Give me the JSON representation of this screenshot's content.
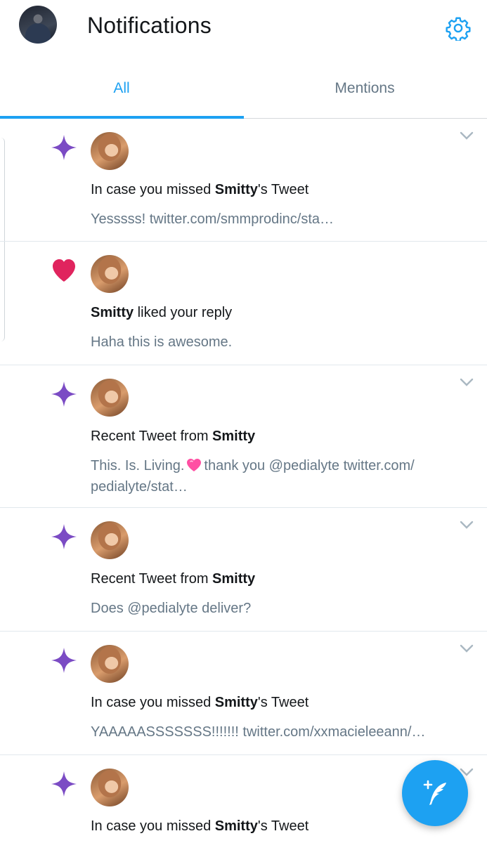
{
  "header": {
    "title": "Notifications",
    "settings_icon": "gear-icon",
    "accent_color": "#1da1f2"
  },
  "tabs": [
    {
      "label": "All",
      "selected": true
    },
    {
      "label": "Mentions",
      "selected": false
    }
  ],
  "notifications": [
    {
      "type_icon": "sparkle-icon",
      "headline_prefix": "In case you missed ",
      "headline_name": "Smitty",
      "headline_suffix": "'s Tweet",
      "preview": "Yesssss! twitter.com/smmprodinc/sta…",
      "has_chevron": true
    },
    {
      "type_icon": "heart-icon",
      "headline_prefix": "",
      "headline_name": "Smitty",
      "headline_suffix": " liked your reply",
      "preview": "Haha this is awesome.",
      "has_chevron": false
    },
    {
      "type_icon": "sparkle-icon",
      "headline_prefix": "Recent Tweet from ",
      "headline_name": "Smitty",
      "headline_suffix": "",
      "preview_before_emoji": "This. Is. Living.",
      "preview_after_emoji": "thank you @pedialyte twitter.com/ pedialyte/stat…",
      "has_chevron": true
    },
    {
      "type_icon": "sparkle-icon",
      "headline_prefix": "Recent Tweet from ",
      "headline_name": "Smitty",
      "headline_suffix": "",
      "preview": "Does @pedialyte deliver?",
      "has_chevron": true
    },
    {
      "type_icon": "sparkle-icon",
      "headline_prefix": "In case you missed ",
      "headline_name": "Smitty",
      "headline_suffix": "'s Tweet",
      "preview": "YAAAAASSSSSSS!!!!!!! twitter.com/xxmacieleeann/…",
      "has_chevron": true
    },
    {
      "type_icon": "sparkle-icon",
      "headline_prefix": "In case you missed ",
      "headline_name": "Smitty",
      "headline_suffix": "'s Tweet",
      "has_chevron": true
    }
  ],
  "fab": {
    "icon": "compose-tweet-icon"
  },
  "colors": {
    "sparkle": "#7b4bc4",
    "heart": "#e0245e",
    "secondary_text": "#657786"
  }
}
